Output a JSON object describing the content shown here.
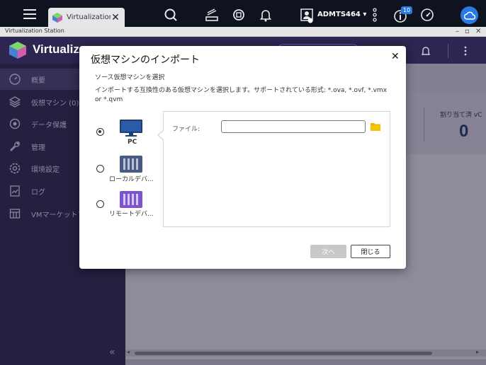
{
  "taskbar": {
    "tab_label": "Virtualization...",
    "user_name": "ADMTS464 ▾",
    "notification_count": "10"
  },
  "window": {
    "title": "Virtualization Station",
    "controls": [
      "–",
      "▫",
      "✕"
    ]
  },
  "app": {
    "name": "Virtualiz"
  },
  "sidebar": {
    "items": [
      {
        "label": "概要",
        "icon": "dashboard-icon"
      },
      {
        "label": "仮想マシン (0)",
        "icon": "vm-icon"
      },
      {
        "label": "データ保護",
        "icon": "data-protection-icon"
      },
      {
        "label": "管理",
        "icon": "wrench-icon"
      },
      {
        "label": "環境設定",
        "icon": "gear-icon"
      },
      {
        "label": "ログ",
        "icon": "log-icon"
      },
      {
        "label": "VMマーケットプ",
        "icon": "market-icon"
      }
    ],
    "collapse_glyph": "«"
  },
  "main": {
    "allocated_label": "割り当て済 vC",
    "allocated_value": "0"
  },
  "dialog": {
    "title": "仮想マシンのインポート",
    "close_glyph": "✕",
    "subtitle": "ソース仮想マシンを選択",
    "description": "インポートする互換性のある仮想マシンを選択します。サポートされている形式: *.ova, *.ovf, *.vmx or *.qvm",
    "sources": [
      {
        "label": "PC",
        "selected": true
      },
      {
        "label": "ローカルデバ...",
        "selected": false
      },
      {
        "label": "リモートデバ...",
        "selected": false
      }
    ],
    "file_label": "ファイル:",
    "file_value": "",
    "next_button": "次へ",
    "close_button": "閉じる"
  },
  "colors": {
    "accent": "#2a7ae4",
    "sidebar_bg": "#2a2547",
    "header_bg": "#2c2650",
    "folder": "#f0b400"
  }
}
